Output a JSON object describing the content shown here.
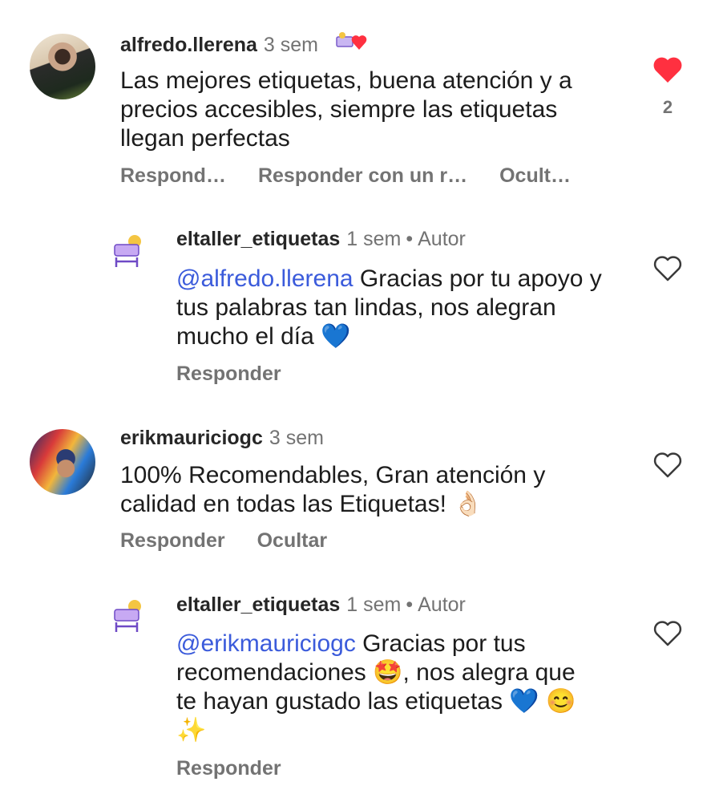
{
  "comments": [
    {
      "user": "alfredo.llerena",
      "time": "3 sem",
      "badge_emoji": "🛏❤",
      "text": "Las mejores etiquetas, buena atención y a precios accesibles, siempre las etiquetas llegan perfectas",
      "actions": [
        "Respond…",
        "Responder con un r…",
        "Ocult…"
      ],
      "liked": true,
      "like_count": "2"
    },
    {
      "user": "eltaller_etiquetas",
      "time": "1 sem",
      "separator": "•",
      "role": "Autor",
      "mention": "@alfredo.llerena",
      "text": " Gracias por tu apoyo y tus palabras tan lindas, nos alegran mucho el día ",
      "emoji": "💙",
      "actions": [
        "Responder"
      ],
      "liked": false
    },
    {
      "user": "erikmauriciogc",
      "time": "3 sem",
      "text": "100% Recomendables, Gran atención y calidad en todas las Etiquetas! ",
      "emoji": "👌🏻",
      "actions": [
        "Responder",
        "Ocultar"
      ],
      "liked": false
    },
    {
      "user": "eltaller_etiquetas",
      "time": "1 sem",
      "separator": "•",
      "role": "Autor",
      "mention": "@erikmauriciogc",
      "text_a": " Gracias por tus recomendaciones ",
      "emoji_a": "🤩",
      "text_b": ", nos alegra que te hayan gustado las etiquetas ",
      "emoji_b": "💙 😊 ✨",
      "actions": [
        "Responder"
      ],
      "liked": false
    }
  ],
  "colors": {
    "like_red": "#ff3040",
    "mention": "#3b5bdb",
    "muted": "#737373"
  },
  "icons": {
    "liked": "heart-filled-icon",
    "like": "heart-outline-icon"
  }
}
